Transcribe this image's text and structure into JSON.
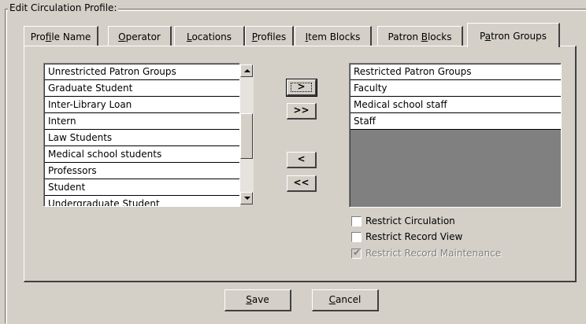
{
  "group_title": "Edit  Circulation Profile:",
  "tabs": [
    {
      "label": "Profile Name"
    },
    {
      "label": "Operator"
    },
    {
      "label": "Locations"
    },
    {
      "label": "Profiles"
    },
    {
      "label": "Item Blocks"
    },
    {
      "label": "Patron Blocks"
    },
    {
      "label": "Patron Groups",
      "active": true
    }
  ],
  "unrestricted": {
    "header": "Unrestricted Patron Groups",
    "items": [
      "Graduate Student",
      "Inter-Library Loan",
      "Intern",
      "Law Students",
      "Medical school students",
      "Professors",
      "Student",
      "Undergraduate Student"
    ]
  },
  "restricted": {
    "header": "Restricted Patron Groups",
    "items": [
      "Faculty",
      "Medical school staff",
      "Staff"
    ]
  },
  "move_buttons": {
    "add_one": ">",
    "add_all": ">>",
    "remove_one": "<",
    "remove_all": "<<"
  },
  "options": [
    {
      "label": "Restrict Circulation",
      "checked": false,
      "disabled": false
    },
    {
      "label": "Restrict Record View",
      "checked": false,
      "disabled": false
    },
    {
      "label": "Restrict Record Maintenance",
      "checked": true,
      "disabled": true
    }
  ],
  "footer": {
    "save": "Save",
    "cancel": "Cancel"
  }
}
